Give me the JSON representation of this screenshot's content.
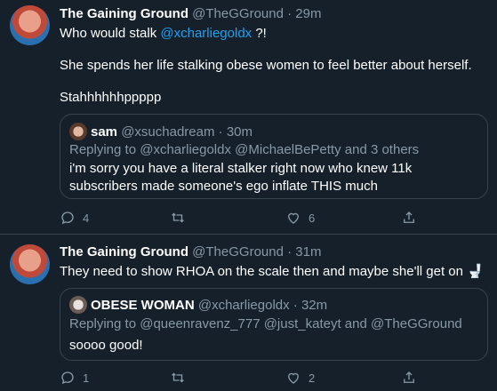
{
  "tweets": [
    {
      "name": "The Gaining Ground",
      "handle": "@TheGGround",
      "time": "29m",
      "text_prefix": "Who would stalk ",
      "text_mention": "@xcharliegoldx",
      "text_suffix": " ?!",
      "para2": "She spends her life stalking obese women to feel better about herself.",
      "para3": "Stahhhhhhppppp",
      "quote": {
        "name": "sam",
        "handle": "@xsuchadream",
        "time": "30m",
        "reply": "Replying to @xcharliegoldx @MichaelBePetty and 3 others",
        "text": "i'm sorry you have a literal stalker right now who knew 11k subscribers made someone's ego inflate THIS much"
      },
      "replies": "4",
      "retweets": "",
      "likes": "6"
    },
    {
      "name": "The Gaining Ground",
      "handle": "@TheGGround",
      "time": "31m",
      "text": "They need to show RHOA on the scale then and maybe she'll get on",
      "emoji": "🚽",
      "quote": {
        "name": "OBESE WOMAN",
        "handle": "@xcharliegoldx",
        "time": "32m",
        "reply": "Replying to @queenravenz_777 @just_kateyt and @TheGGround",
        "text": "soooo good!"
      },
      "replies": "1",
      "retweets": "",
      "likes": "2"
    }
  ],
  "separator": "·",
  "colors": {
    "bg": "#15202b",
    "muted": "#8899a6",
    "link": "#1da1f2",
    "border": "#38444d"
  }
}
